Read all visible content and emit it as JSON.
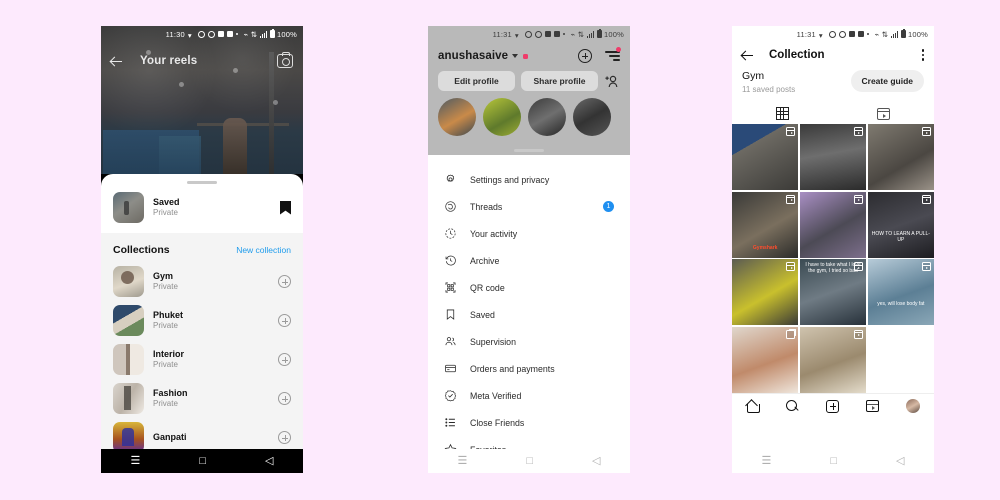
{
  "background_color": "#fdeafd",
  "phone1": {
    "status_bar": {
      "time": "11:30",
      "battery": "100%"
    },
    "header": {
      "title": "Your reels",
      "back_icon": "arrow-left-icon",
      "camera_icon": "camera-icon"
    },
    "sheet": {
      "saved": {
        "title": "Saved",
        "subtitle": "Private",
        "bookmark_icon": "bookmark-filled-icon"
      },
      "collections_header": {
        "title": "Collections",
        "action": "New collection"
      },
      "collections": [
        {
          "title": "Gym",
          "subtitle": "Private",
          "action_icon": "plus-circle-icon"
        },
        {
          "title": "Phuket",
          "subtitle": "Private",
          "action_icon": "plus-circle-icon"
        },
        {
          "title": "Interior",
          "subtitle": "Private",
          "action_icon": "plus-circle-icon"
        },
        {
          "title": "Fashion",
          "subtitle": "Private",
          "action_icon": "plus-circle-icon"
        },
        {
          "title": "Ganpati",
          "subtitle": "",
          "action_icon": "plus-circle-icon"
        }
      ]
    },
    "nav": {
      "recents": "☰",
      "home": "□",
      "back": "◁"
    }
  },
  "phone2": {
    "status_bar": {
      "time": "11:31",
      "battery": "100%"
    },
    "header": {
      "username": "anushasaive",
      "caret_icon": "chevron-down-icon",
      "new_post_icon": "plus-circle-icon",
      "hamburger_icon": "menu-icon"
    },
    "buttons": {
      "edit_profile": "Edit profile",
      "share_profile": "Share profile",
      "add_person_icon": "add-person-icon"
    },
    "menu_items": [
      {
        "label": "Settings and privacy",
        "icon": "gear-icon",
        "badge": ""
      },
      {
        "label": "Threads",
        "icon": "threads-icon",
        "badge": "1"
      },
      {
        "label": "Your activity",
        "icon": "activity-clock-icon",
        "badge": ""
      },
      {
        "label": "Archive",
        "icon": "archive-clock-icon",
        "badge": ""
      },
      {
        "label": "QR code",
        "icon": "qr-code-icon",
        "badge": ""
      },
      {
        "label": "Saved",
        "icon": "bookmark-icon",
        "badge": ""
      },
      {
        "label": "Supervision",
        "icon": "supervision-people-icon",
        "badge": ""
      },
      {
        "label": "Orders and payments",
        "icon": "credit-card-icon",
        "badge": ""
      },
      {
        "label": "Meta Verified",
        "icon": "verified-badge-icon",
        "badge": ""
      },
      {
        "label": "Close Friends",
        "icon": "list-icon",
        "badge": ""
      },
      {
        "label": "Favorites",
        "icon": "star-icon",
        "badge": ""
      }
    ],
    "nav": {
      "recents": "☰",
      "home": "□",
      "back": "◁"
    }
  },
  "phone3": {
    "status_bar": {
      "time": "11:31",
      "battery": "100%"
    },
    "header": {
      "title": "Collection",
      "back_icon": "arrow-left-icon",
      "more_icon": "more-vertical-icon"
    },
    "collection": {
      "name": "Gym",
      "saved_count": "11 saved posts",
      "create_guide": "Create guide"
    },
    "tabs": [
      {
        "name": "grid-tab",
        "icon": "grid-icon",
        "active": true
      },
      {
        "name": "reels-tab",
        "icon": "reels-icon",
        "active": false
      }
    ],
    "grid": [
      {
        "id": "c1",
        "overlay": "reel-icon",
        "caption": ""
      },
      {
        "id": "c2",
        "overlay": "reel-icon",
        "caption": ""
      },
      {
        "id": "c3",
        "overlay": "reel-icon",
        "caption": ""
      },
      {
        "id": "c4",
        "overlay": "reel-icon",
        "caption": ""
      },
      {
        "id": "c5",
        "overlay": "reel-icon",
        "caption": ""
      },
      {
        "id": "c6",
        "overlay": "reel-icon",
        "caption": "HOW TO LEARN A PULL-UP"
      },
      {
        "id": "c7",
        "overlay": "reel-icon",
        "caption": "Gymshark"
      },
      {
        "id": "c8",
        "overlay": "reel-icon",
        "caption": "I have to take what I love the gym, I tried so bad"
      },
      {
        "id": "c9",
        "overlay": "reel-icon",
        "caption": "yes, will lose body fat"
      },
      {
        "id": "c10",
        "overlay": "carousel-icon",
        "caption": ""
      },
      {
        "id": "c11",
        "overlay": "reel-icon",
        "caption": ""
      },
      {
        "id": "c12",
        "overlay": "",
        "caption": ""
      }
    ],
    "tabbar": [
      {
        "name": "home-tab",
        "icon": "home-icon"
      },
      {
        "name": "search-tab",
        "icon": "search-icon"
      },
      {
        "name": "create-tab",
        "icon": "plus-square-icon"
      },
      {
        "name": "reels-tab",
        "icon": "reels-icon"
      },
      {
        "name": "profile-tab",
        "icon": "avatar-icon"
      }
    ],
    "nav": {
      "recents": "☰",
      "home": "□",
      "back": "◁"
    }
  }
}
